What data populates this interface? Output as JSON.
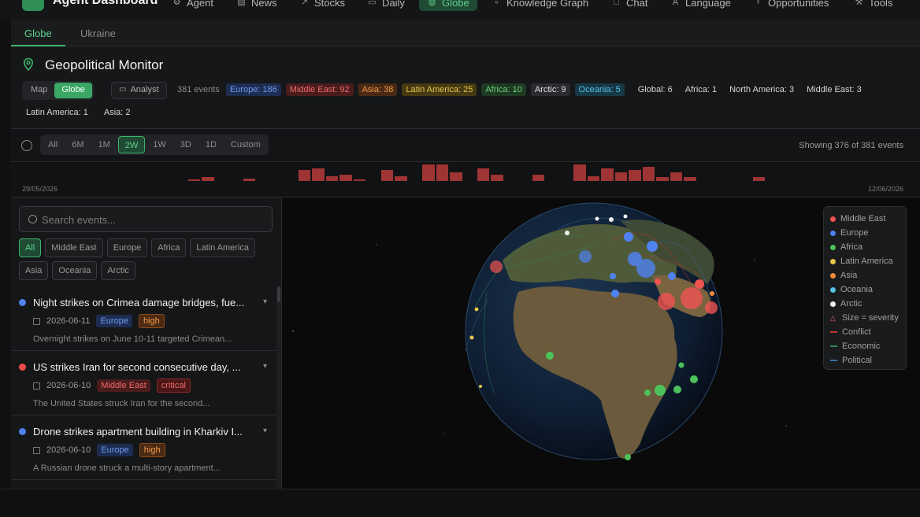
{
  "app": {
    "title": "Agent Dashboard"
  },
  "nav": [
    {
      "label": "Agent",
      "icon": "agent-icon"
    },
    {
      "label": "News",
      "icon": "news-icon"
    },
    {
      "label": "Stocks",
      "icon": "stocks-icon"
    },
    {
      "label": "Daily",
      "icon": "daily-icon"
    },
    {
      "label": "Globe",
      "icon": "globe-icon",
      "active": true
    },
    {
      "label": "Knowledge Graph",
      "icon": "graph-icon"
    },
    {
      "label": "Chat",
      "icon": "chat-icon"
    },
    {
      "label": "Language",
      "icon": "language-icon"
    },
    {
      "label": "Opportunities",
      "icon": "lightbulb-icon"
    },
    {
      "label": "Tools",
      "icon": "wrench-icon"
    }
  ],
  "subtabs": [
    {
      "label": "Globe",
      "active": true
    },
    {
      "label": "Ukraine"
    }
  ],
  "monitor": {
    "title": "Geopolitical Monitor",
    "view_modes": [
      "Map",
      "Globe"
    ],
    "active_view": "Globe",
    "analyst_label": "Analyst",
    "event_count": "381 events",
    "region_chips": [
      {
        "label": "Europe: 186",
        "bg": "#1d2d52",
        "fg": "#6f9af0"
      },
      {
        "label": "Middle East: 92",
        "bg": "#4a1c1c",
        "fg": "#ef6a6a"
      },
      {
        "label": "Asia: 38",
        "bg": "#4a2a14",
        "fg": "#f39a4a"
      },
      {
        "label": "Latin America: 25",
        "bg": "#453a12",
        "fg": "#e8c44a"
      },
      {
        "label": "Africa: 10",
        "bg": "#1e3a22",
        "fg": "#6ad07a"
      },
      {
        "label": "Arctic: 9",
        "bg": "#2a2b2e",
        "fg": "#e0e0e0"
      },
      {
        "label": "Oceania: 5",
        "bg": "#173845",
        "fg": "#56c2e6"
      }
    ],
    "plain_chips": [
      "Global: 6",
      "Africa: 1",
      "North America: 3",
      "Middle East: 3"
    ],
    "plain_chips_row2": [
      "Latin America: 1",
      "Asia: 2"
    ]
  },
  "time": {
    "ranges": [
      "All",
      "6M",
      "1M",
      "2W",
      "1W",
      "3D",
      "1D",
      "Custom"
    ],
    "active": "2W",
    "showing": "Showing 376 of 381 events",
    "start_date": "29/05/2026",
    "end_date": "12/06/2026",
    "histogram": [
      0,
      0,
      0,
      0,
      0,
      0,
      0,
      0,
      0,
      0,
      0,
      0,
      1,
      3,
      0,
      0,
      2,
      0,
      0,
      0,
      9,
      10,
      4,
      5,
      1,
      0,
      9,
      4,
      0,
      13,
      13,
      7,
      0,
      10,
      5,
      0,
      0,
      5,
      0,
      0,
      13,
      4,
      10,
      7,
      9,
      11,
      3,
      7,
      3,
      0,
      0,
      0,
      0,
      3,
      0,
      0,
      0,
      0,
      0,
      0,
      0,
      0,
      0,
      0
    ]
  },
  "search": {
    "placeholder": "Search events..."
  },
  "filters": [
    "All",
    "Middle East",
    "Europe",
    "Africa",
    "Latin America",
    "Asia",
    "Oceania",
    "Arctic"
  ],
  "active_filter": "All",
  "events": [
    {
      "title": "Night strikes on Crimea damage bridges, fue...",
      "date": "2026-06-11",
      "region": "Europe",
      "severity": "high",
      "desc": "Overnight strikes on June 10-11 targeted Crimean...",
      "color": "#4f82f0"
    },
    {
      "title": "US strikes Iran for second consecutive day, ...",
      "date": "2026-06-10",
      "region": "Middle East",
      "severity": "critical",
      "desc": "The United States struck Iran for the second...",
      "color": "#ef4a4a"
    },
    {
      "title": "Drone strikes apartment building in Kharkiv I...",
      "date": "2026-06-10",
      "region": "Europe",
      "severity": "high",
      "desc": "A Russian drone struck a multi-story apartment...",
      "color": "#4f82f0"
    }
  ],
  "legend": {
    "regions": [
      {
        "label": "Middle East",
        "color": "#ef5350"
      },
      {
        "label": "Europe",
        "color": "#4f82f0"
      },
      {
        "label": "Africa",
        "color": "#4cc25a"
      },
      {
        "label": "Latin America",
        "color": "#e8c44a"
      },
      {
        "label": "Asia",
        "color": "#f08a3a"
      },
      {
        "label": "Oceania",
        "color": "#56c2e6"
      },
      {
        "label": "Arctic",
        "color": "#f0f0f0"
      }
    ],
    "size_note": "Size = severity",
    "links": [
      {
        "label": "Conflict",
        "color": "#c0392b"
      },
      {
        "label": "Economic",
        "color": "#2e8b57"
      },
      {
        "label": "Political",
        "color": "#3a6ea5"
      }
    ]
  }
}
